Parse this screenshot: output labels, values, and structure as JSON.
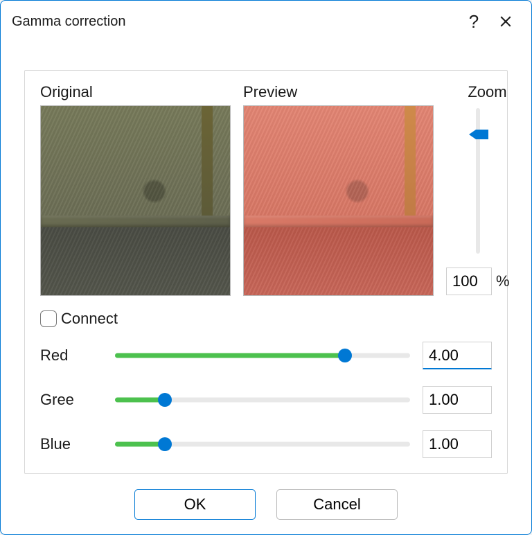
{
  "window": {
    "title": "Gamma correction"
  },
  "labels": {
    "original": "Original",
    "preview": "Preview",
    "zoom": "Zoom",
    "connect": "Connect",
    "red": "Red",
    "green": "Gree",
    "blue": "Blue",
    "percent": "%"
  },
  "zoom": {
    "value": "100"
  },
  "sliders": {
    "red": {
      "value": "4.00",
      "fill_pct": 78
    },
    "green": {
      "value": "1.00",
      "fill_pct": 17
    },
    "blue": {
      "value": "1.00",
      "fill_pct": 17
    }
  },
  "connect_checked": false,
  "buttons": {
    "ok": "OK",
    "cancel": "Cancel"
  },
  "colors": {
    "accent": "#0078d4",
    "slider_fill": "#4cc14e"
  }
}
